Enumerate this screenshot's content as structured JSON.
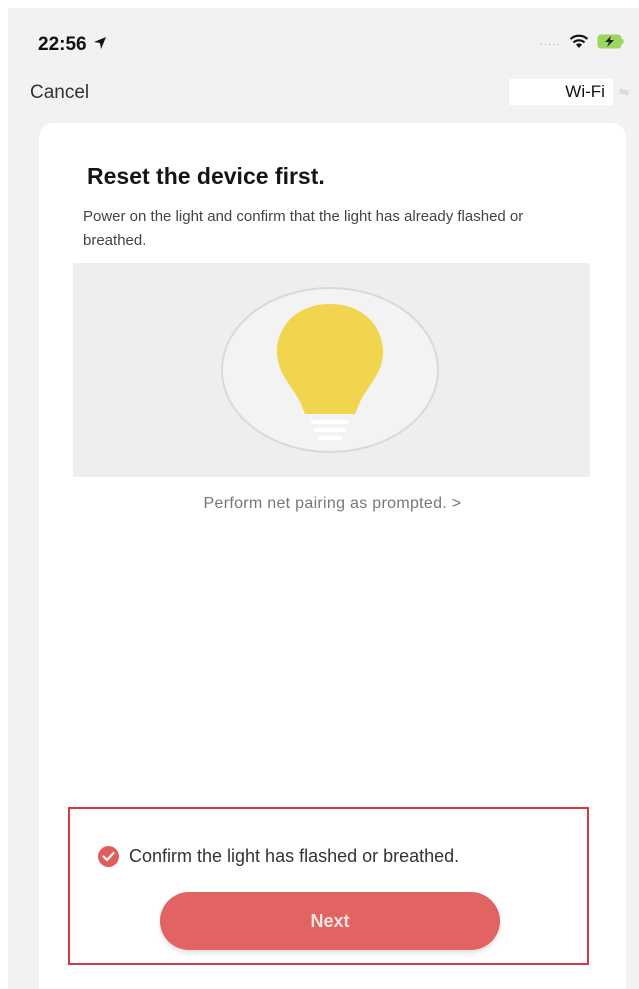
{
  "status_bar": {
    "time": "22:56",
    "location_icon": "location-arrow-icon",
    "signal_icon": "signal-icon",
    "wifi_icon": "wifi-icon",
    "battery_icon": "battery-charging-icon"
  },
  "nav": {
    "cancel_label": "Cancel",
    "wifi_label": "Wi-Fi"
  },
  "card": {
    "title": "Reset the device first.",
    "description": "Power on the light and confirm that the light has already flashed or breathed.",
    "illustration_icon": "light-bulb-icon",
    "link_text": "Perform net pairing as prompted. >"
  },
  "footer": {
    "confirm_text": "Confirm the light has flashed or breathed.",
    "confirm_checked": true,
    "next_label": "Next"
  },
  "colors": {
    "accent": "#e26462",
    "highlight_border": "#d7383c",
    "bulb": "#f2d54e"
  }
}
